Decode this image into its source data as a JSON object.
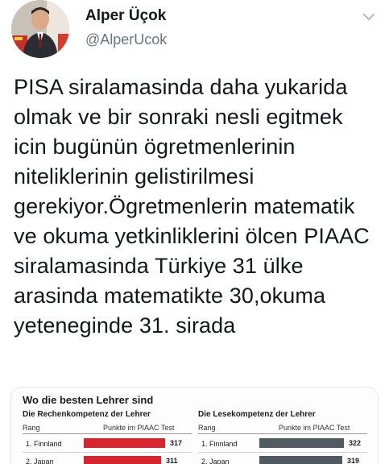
{
  "author": {
    "display_name": "Alper Üçok",
    "handle": "@AlperUcok"
  },
  "tweet": {
    "text": "PISA siralamasinda daha yukarida olmak ve bir sonraki nesli egitmek icin bugünün ögretmenlerinin niteliklerinin gelistirilmesi gerekiyor.Ögretmenlerin matematik ve okuma yetkinliklerini ölcen PIAAC siralamasinda Türkiye 31 ülke arasinda matematikte 30,okuma yeteneginde 31. sirada"
  },
  "media": {
    "title": "Wo die besten Lehrer sind",
    "math": {
      "title": "Die Rechenkompetenz der Lehrer",
      "col_rank": "Rang",
      "col_points": "Punkte im PIAAC Test",
      "rows": [
        {
          "rank_country": "1. Finnland",
          "value": 317
        },
        {
          "rank_country": "2. Japan",
          "value": 311
        }
      ],
      "bar_color": "#d7262e"
    },
    "reading": {
      "title": "Die Lesekompetenz der Lehrer",
      "col_rank": "Rang",
      "col_points": "Punkte im PIAAC Test",
      "rows": [
        {
          "rank_country": "1. Finnland",
          "value": 322
        },
        {
          "rank_country": "2. Japan",
          "value": 319
        }
      ],
      "bar_color": "#4f5b60"
    }
  },
  "icons": {
    "caret": "chevron-down-icon"
  },
  "colors": {
    "text": "#14171a",
    "handle": "#657786",
    "border": "#e1e8ed"
  }
}
